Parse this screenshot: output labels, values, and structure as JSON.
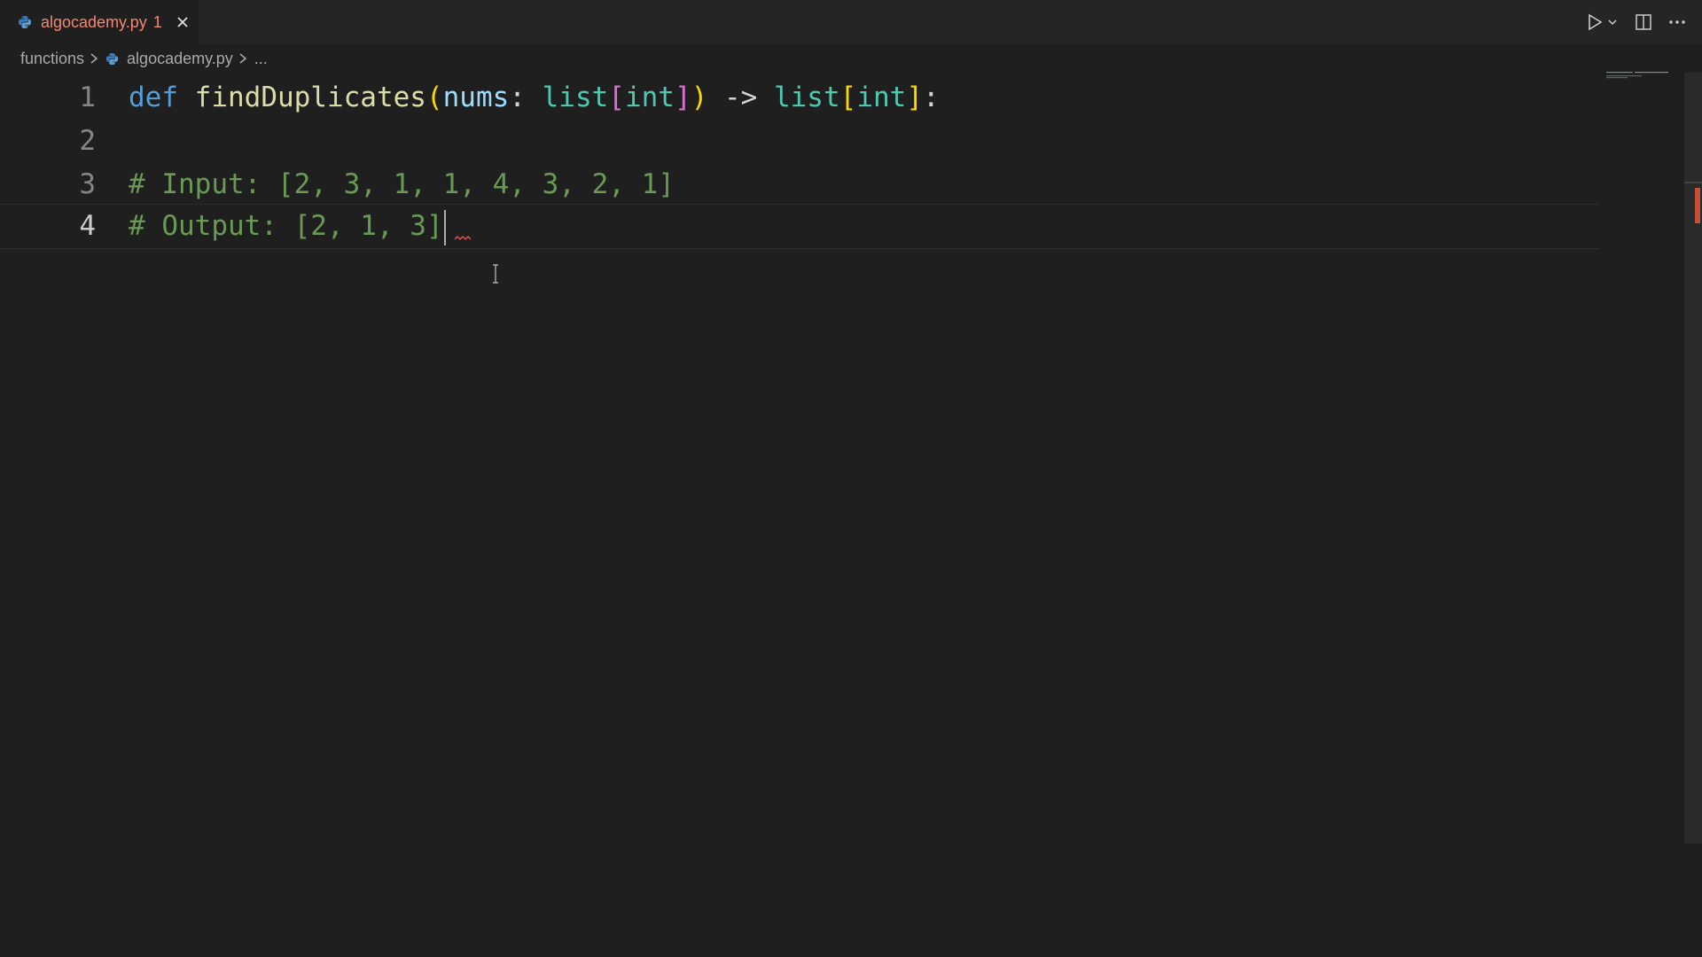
{
  "tab": {
    "filename": "algocademy.py",
    "problem_count": "1",
    "close_icon": "close-icon",
    "file_icon": "python-file-icon"
  },
  "editor_actions": {
    "run_icon": "play-icon",
    "run_dropdown_icon": "chevron-down-icon",
    "split_icon": "split-editor-icon",
    "more_icon": "ellipsis-icon"
  },
  "breadcrumb": {
    "folder": "functions",
    "file": "algocademy.py",
    "symbol": "..."
  },
  "code_lines": [
    {
      "number": "1"
    },
    {
      "number": "2"
    },
    {
      "number": "3",
      "text": "# Input: [2, 3, 1, 1, 4, 3, 2, 1]"
    },
    {
      "number": "4",
      "text": "# Output: [2, 1, 3]"
    }
  ],
  "code": {
    "line1": {
      "kw": "def",
      "fn": "findDuplicates",
      "open_paren": "(",
      "param": "nums",
      "colon1": ":",
      "type1": "list",
      "open_bracket1": "[",
      "type1_inner": "int",
      "close_bracket1": "]",
      "close_paren": ")",
      "arrow": "->",
      "type2": "list",
      "open_bracket2": "[",
      "type2_inner": "int",
      "close_bracket2": "]",
      "colon2": ":"
    }
  },
  "colors": {
    "background": "#1f1f1f",
    "tab_error_text": "#f48771",
    "keyword": "#569cd6",
    "function": "#dcdcaa",
    "type": "#4ec9b0",
    "comment": "#6a9955",
    "error_marker": "#c74e39"
  }
}
